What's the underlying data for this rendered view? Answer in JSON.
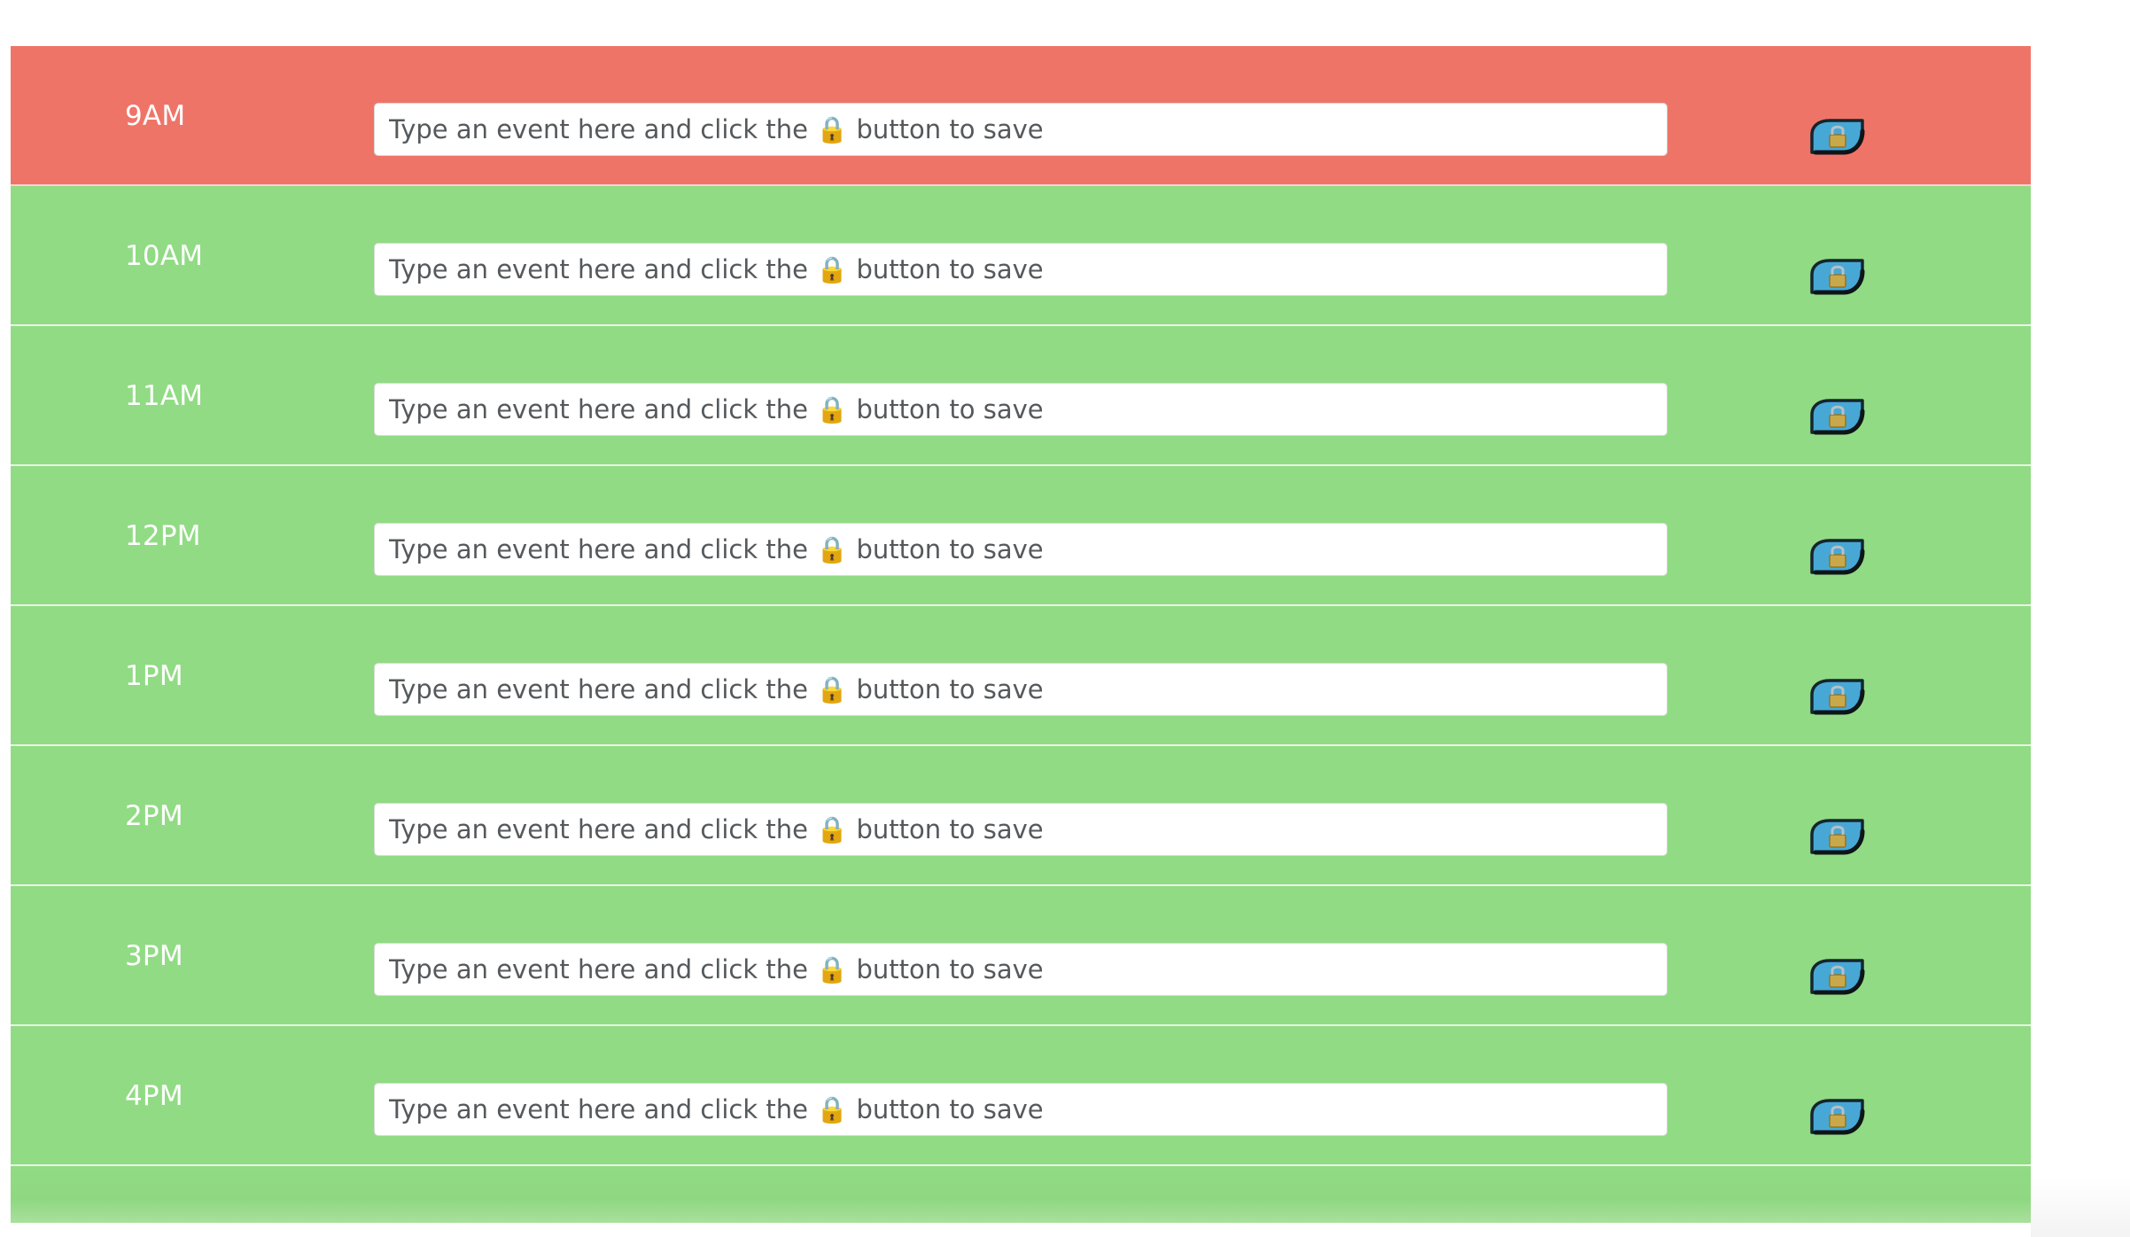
{
  "colors": {
    "present": "#ef7468",
    "past": "#91db84",
    "future": "#91db84",
    "save_button": "#47a8d6"
  },
  "icons": {
    "save_button": "lock-icon"
  },
  "timeblocks": [
    {
      "hour": "9AM",
      "status": "present",
      "event": "",
      "placeholder": "Type an event here and click the 🔒 button to save"
    },
    {
      "hour": "10AM",
      "status": "future",
      "event": "",
      "placeholder": "Type an event here and click the 🔒 button to save"
    },
    {
      "hour": "11AM",
      "status": "future",
      "event": "",
      "placeholder": "Type an event here and click the 🔒 button to save"
    },
    {
      "hour": "12PM",
      "status": "future",
      "event": "",
      "placeholder": "Type an event here and click the 🔒 button to save"
    },
    {
      "hour": "1PM",
      "status": "future",
      "event": "",
      "placeholder": "Type an event here and click the 🔒 button to save"
    },
    {
      "hour": "2PM",
      "status": "future",
      "event": "",
      "placeholder": "Type an event here and click the 🔒 button to save"
    },
    {
      "hour": "3PM",
      "status": "future",
      "event": "",
      "placeholder": "Type an event here and click the 🔒 button to save"
    },
    {
      "hour": "4PM",
      "status": "future",
      "event": "",
      "placeholder": "Type an event here and click the 🔒 button to save"
    }
  ]
}
